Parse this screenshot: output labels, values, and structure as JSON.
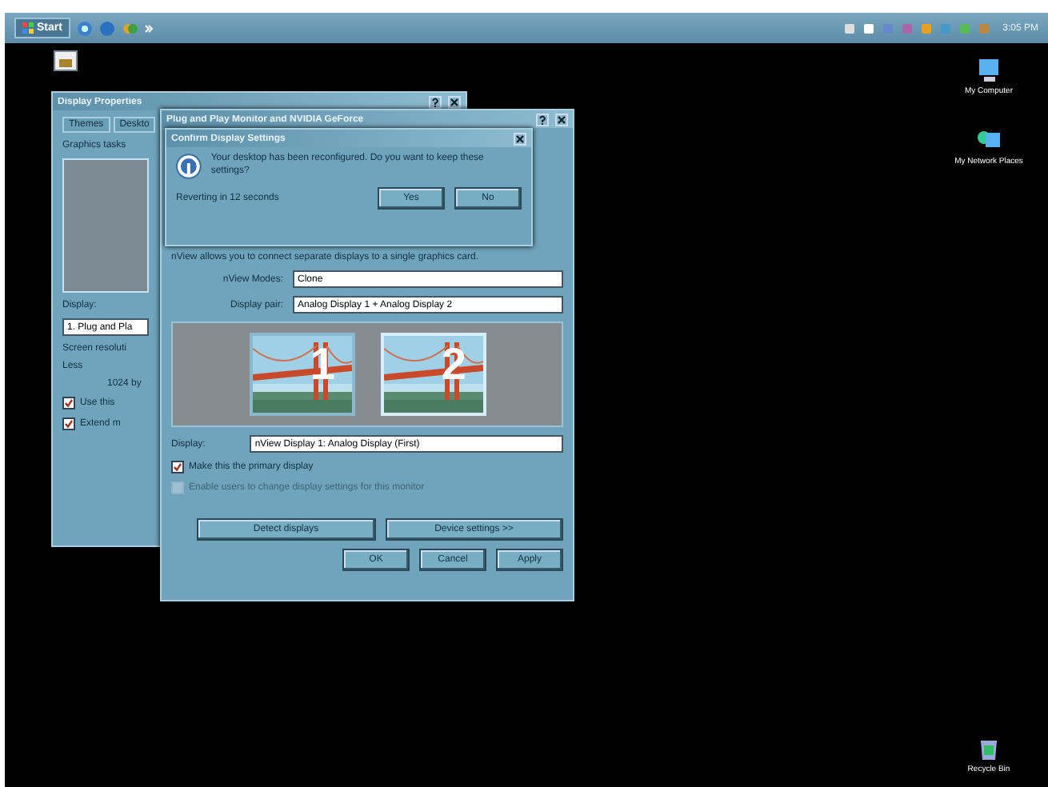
{
  "taskbar": {
    "start": "Start",
    "clock": "3:05 PM"
  },
  "desktop_icons": [
    {
      "label": "My Computer",
      "kind": "computer"
    },
    {
      "label": "My Network Places",
      "kind": "network"
    },
    {
      "label": "Recycle Bin",
      "kind": "bin"
    }
  ],
  "display_properties": {
    "title": "Display Properties",
    "tabs": [
      {
        "label": "Themes",
        "selected": false
      },
      {
        "label": "Deskto",
        "selected": false
      }
    ],
    "section": "Graphics tasks",
    "display_label": "Display:",
    "display_value": "1. Plug and Pla",
    "resolution_label": "Screen resoluti",
    "less": "Less",
    "resolution": "1024 by",
    "checkboxes": [
      {
        "label": "Use this",
        "checked": true
      },
      {
        "label": "Extend m",
        "checked": true
      }
    ]
  },
  "nview_window": {
    "title": "Plug and Play Monitor and NVIDIA GeForce",
    "intro": "nView allows you to connect separate displays to a single graphics card.",
    "mode_label": "nView Modes:",
    "mode_value": "Clone",
    "pair_label": "Display pair:",
    "pair_value": "Analog Display 1 + Analog Display 2",
    "monitors": [
      {
        "number": "1",
        "selected": false
      },
      {
        "number": "2",
        "selected": true
      }
    ],
    "display_label": "Display:",
    "display_value": "nView Display 1: Analog Display (First)",
    "checkboxes": [
      {
        "label": "Make this the primary display",
        "checked": true,
        "disabled": false
      },
      {
        "label": "Enable users to change display settings for this monitor",
        "checked": false,
        "disabled": true
      }
    ],
    "buttons": [
      "Detect displays",
      "Device settings >>"
    ],
    "footer_buttons": [
      "OK",
      "Cancel",
      "Apply"
    ]
  },
  "confirm_dialog": {
    "title": "Confirm Display Settings",
    "message": "Your desktop has been reconfigured. Do you want to keep these settings?",
    "countdown": "Reverting in 12 seconds",
    "buttons": [
      "Yes",
      "No"
    ]
  }
}
